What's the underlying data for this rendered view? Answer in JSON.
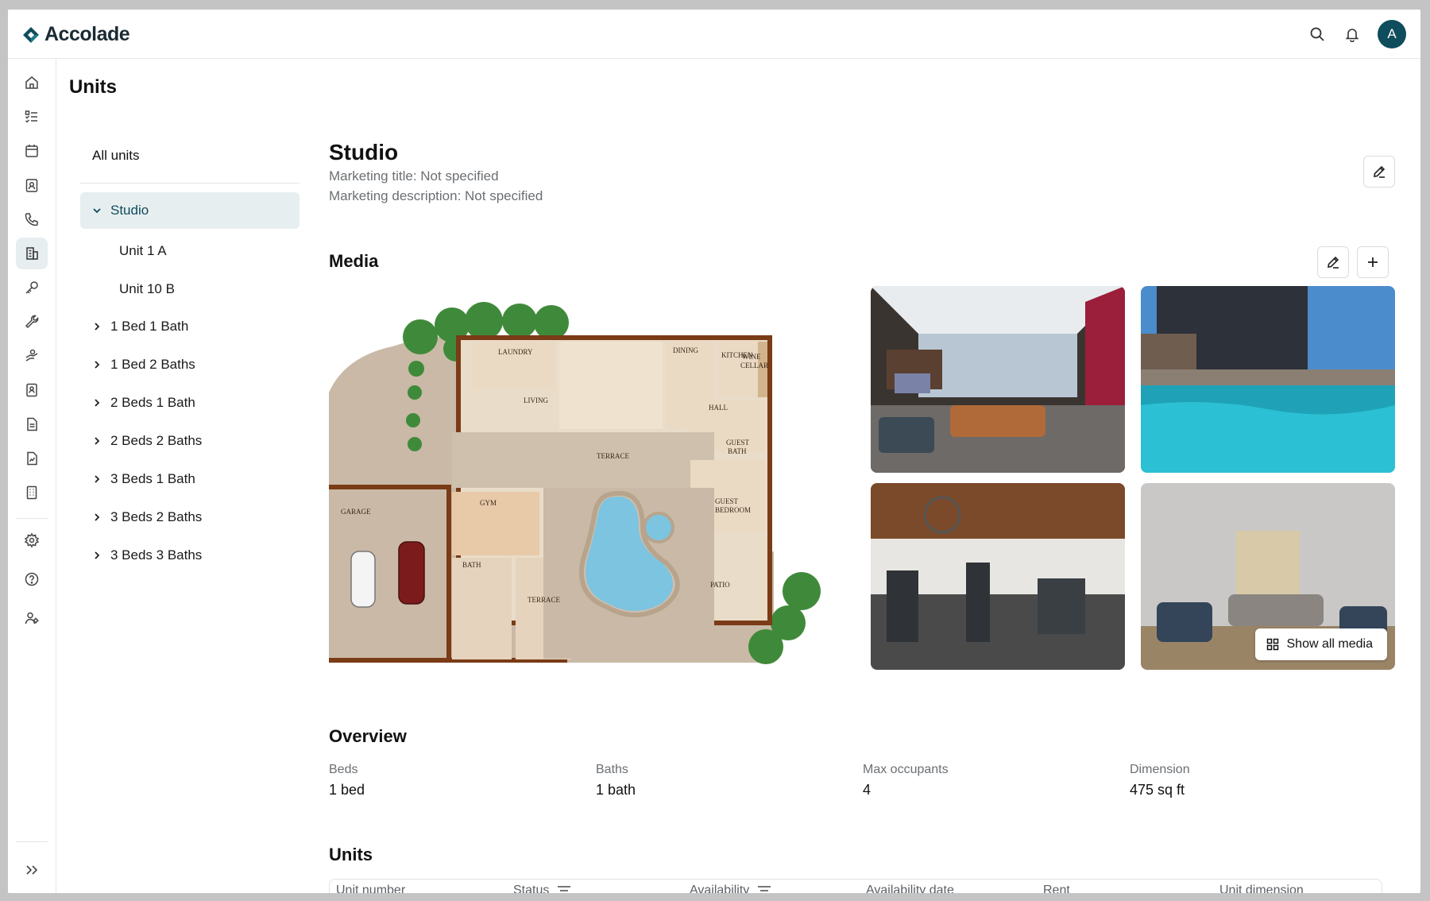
{
  "app": {
    "brand": "Accolade",
    "avatar_initial": "A",
    "accent_color": "#0f4c5c"
  },
  "rail": {
    "items": [
      "home-icon",
      "tasks-icon",
      "calendar-icon",
      "contacts-icon",
      "phone-icon",
      "buildings-icon",
      "key-icon",
      "wrench-icon",
      "payments-icon",
      "tenant-icon",
      "document-icon",
      "report-icon",
      "building-icon"
    ],
    "bottom_items": [
      "settings-icon",
      "help-icon",
      "users-icon"
    ],
    "expand": "expand-icon"
  },
  "page": {
    "title": "Units"
  },
  "tree": {
    "all_units": "All units",
    "groups": [
      {
        "label": "Studio",
        "expanded": true,
        "children": [
          "Unit 1 A",
          "Unit 10 B"
        ]
      },
      {
        "label": "1 Bed 1 Bath"
      },
      {
        "label": "1 Bed 2 Baths"
      },
      {
        "label": "2 Beds 1 Bath"
      },
      {
        "label": "2 Beds 2 Baths"
      },
      {
        "label": "3 Beds 1 Bath"
      },
      {
        "label": "3 Beds 2 Baths"
      },
      {
        "label": "3 Beds 3 Baths"
      }
    ]
  },
  "detail": {
    "title": "Studio",
    "marketing_title": "Marketing title: Not specified",
    "marketing_description": "Marketing description: Not specified"
  },
  "media": {
    "title": "Media",
    "show_all": "Show all media",
    "floorplan_labels": {
      "laundry": "LAUNDRY",
      "dining": "DINING",
      "kitchen": "KITCHEN",
      "wine_cellar_1": "WINE",
      "wine_cellar_2": "CELLAR",
      "living": "LIVING",
      "hall": "HALL",
      "guest_bath_1": "GUEST",
      "guest_bath_2": "BATH",
      "terrace_top": "TERRACE",
      "gym": "GYM",
      "garage": "GARAGE",
      "guest_bedroom_1": "GUEST",
      "guest_bedroom_2": "BEDROOM",
      "bath": "BATH",
      "terrace_bottom": "TERRACE",
      "patio": "PATIO"
    }
  },
  "overview": {
    "title": "Overview",
    "items": [
      {
        "label": "Beds",
        "value": "1 bed"
      },
      {
        "label": "Baths",
        "value": "1 bath"
      },
      {
        "label": "Max occupants",
        "value": "4"
      },
      {
        "label": "Dimension",
        "value": "475 sq ft"
      }
    ]
  },
  "units_table": {
    "title": "Units",
    "columns": [
      "Unit number",
      "Status",
      "Availability",
      "Availability date",
      "Rent",
      "Unit dimension"
    ]
  }
}
